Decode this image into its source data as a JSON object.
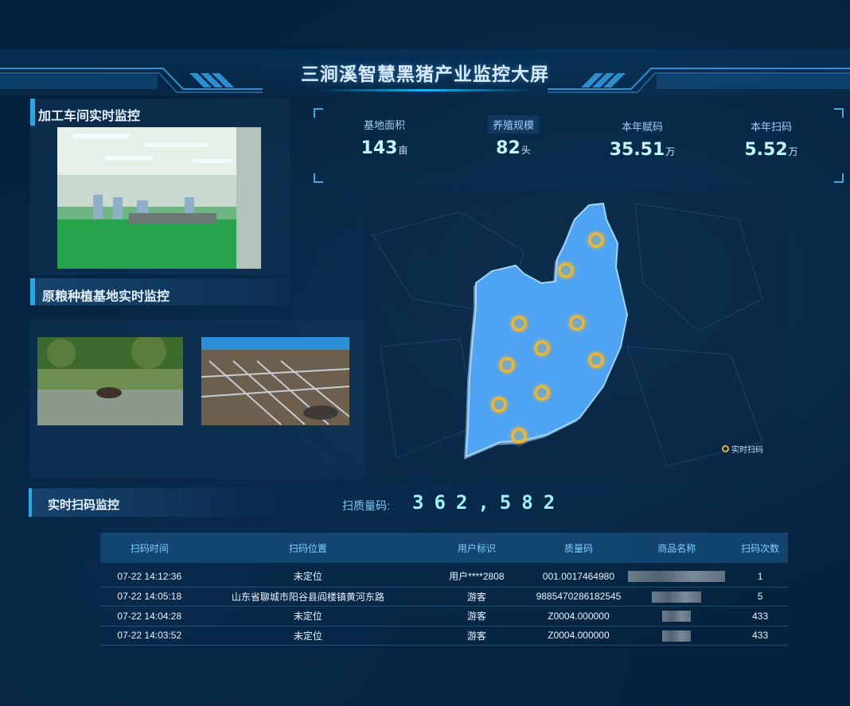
{
  "header": {
    "title": "三涧溪智慧黑猪产业监控大屏"
  },
  "panels": {
    "workshop_title": "加工车间实时监控",
    "base_title": "原粮种植基地实时监控"
  },
  "stats": [
    {
      "label": "基地面积",
      "value": "143",
      "unit": "亩"
    },
    {
      "label": "养殖规模",
      "value": "82",
      "unit": "头"
    },
    {
      "label": "本年赋码",
      "value": "35.51",
      "unit": "万"
    },
    {
      "label": "本年扫码",
      "value": "5.52",
      "unit": "万"
    }
  ],
  "map": {
    "legend_label": "实时扫码",
    "marker_color": "#e7b53c",
    "region_color": "#4ea4f2",
    "marker_count": 10
  },
  "scan": {
    "title": "实时扫码监控",
    "count_label": "扫质量码:",
    "count_value": "362,582"
  },
  "table": {
    "columns": [
      "扫码时间",
      "扫码位置",
      "用户标识",
      "质量码",
      "商品名称",
      "扫码次数"
    ],
    "rows": [
      {
        "time": "07-22 14:12:36",
        "location": "未定位",
        "user": "用户****2808",
        "code": "001.0017464980",
        "count": "1"
      },
      {
        "time": "07-22 14:05:18",
        "location": "山东省聊城市阳谷县阎楼镇黄河东路",
        "user": "游客",
        "code": "9885470286182545",
        "count": "5"
      },
      {
        "time": "07-22 14:04:28",
        "location": "未定位",
        "user": "游客",
        "code": "Z0004.000000",
        "count": "433"
      },
      {
        "time": "07-22 14:03:52",
        "location": "未定位",
        "user": "游客",
        "code": "Z0004.000000",
        "count": "433"
      }
    ]
  },
  "colors": {
    "accent": "#27a9e8",
    "value": "#bff6ff",
    "background": "#04223c"
  }
}
